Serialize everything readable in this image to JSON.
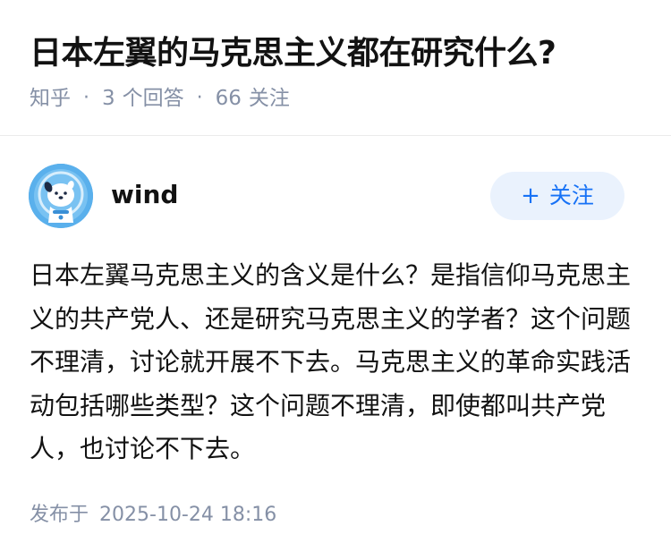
{
  "question": {
    "title": "日本左翼的马克思主义都在研究什么?",
    "source": "知乎",
    "answer_count": "3",
    "answer_label": "个回答",
    "follow_count": "66",
    "follow_label": "关注",
    "separator": "·"
  },
  "answer": {
    "author_name": "wind",
    "follow_button_icon": "+",
    "follow_button_label": "关注",
    "content": "日本左翼马克思主义的含义是什么？是指信仰马克思主义的共产党人、还是研究马克思主义的学者？这个问题不理清，讨论就开展不下去。马克思主义的革命实践活动包括哪些类型？这个问题不理清，即使都叫共产党人，也讨论不下去。",
    "published_label": "发布于",
    "published_time": "2025-10-24 18:16"
  },
  "colors": {
    "accent": "#1772f6",
    "button_bg": "#eaf2fd",
    "meta_text": "#8590a6",
    "divider": "#ebebeb",
    "avatar_bg": "#4aa6e8"
  },
  "icons": {
    "avatar": "cartoon-dog-avatar-icon",
    "follow": "plus-icon"
  }
}
